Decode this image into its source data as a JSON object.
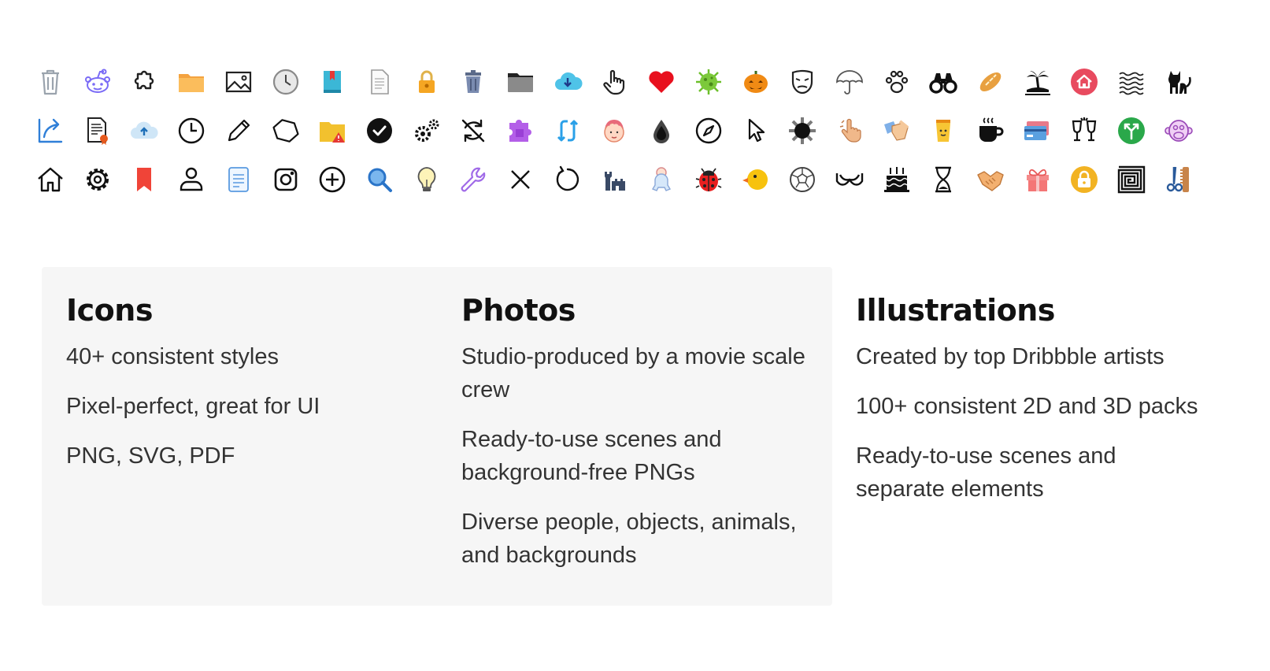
{
  "icon_showcase": {
    "rows": [
      [
        "trash-can-icon",
        "reddit-icon",
        "puzzle-piece-icon",
        "folder-icon",
        "image-icon",
        "clock-icon",
        "book-icon",
        "document-icon",
        "padlock-icon",
        "trash-bin-icon",
        "folder-dark-icon",
        "cloud-download-icon",
        "hand-pointer-icon",
        "heart-icon",
        "virus-icon",
        "pumpkin-icon",
        "mask-icon",
        "umbrella-icon",
        "paw-icon",
        "binoculars-icon",
        "bread-icon",
        "palm-island-icon",
        "home-circle-icon",
        "waves-icon",
        "cat-icon"
      ],
      [
        "share-arrow-icon",
        "certificate-document-icon",
        "cloud-upload-icon",
        "clock-outline-icon",
        "pencil-icon",
        "hexagon-icon",
        "folder-warning-icon",
        "check-circle-icon",
        "gears-icon",
        "sync-off-icon",
        "puzzle-solid-icon",
        "refresh-arrows-icon",
        "person-face-icon",
        "water-drop-icon",
        "compass-icon",
        "cursor-icon",
        "sun-icon",
        "hand-gesture-icon",
        "hands-icon",
        "coffee-cup-icon",
        "mug-icon",
        "credit-card-icon",
        "cheers-icon",
        "merge-arrow-icon",
        "monkey-icon"
      ],
      [
        "house-icon",
        "settings-gear-icon",
        "bookmark-icon",
        "user-icon",
        "text-document-icon",
        "instagram-icon",
        "plus-circle-icon",
        "search-icon",
        "light-bulb-icon",
        "wrench-icon",
        "close-icon",
        "reload-icon",
        "castle-icon",
        "baby-icon",
        "ladybug-icon",
        "duck-icon",
        "soccer-ball-icon",
        "bra-icon",
        "birthday-cake-icon",
        "hourglass-icon",
        "handshake-icon",
        "gift-icon",
        "lock-circle-icon",
        "spiral-square-icon",
        "barber-tools-icon"
      ]
    ]
  },
  "features": {
    "icons": {
      "title": "Icons",
      "items": [
        "40+ consistent styles",
        "Pixel-perfect, great for UI",
        "PNG, SVG, PDF"
      ]
    },
    "photos": {
      "title": "Photos",
      "items": [
        "Studio-produced by a movie scale crew",
        "Ready-to-use scenes and background-free PNGs",
        "Diverse people, objects, animals, and backgrounds"
      ]
    },
    "illustrations": {
      "title": "Illustrations",
      "items": [
        "Created by top Dribbble artists",
        "100+ consistent 2D and 3D packs",
        "Ready-to-use scenes and separate elements"
      ]
    }
  }
}
